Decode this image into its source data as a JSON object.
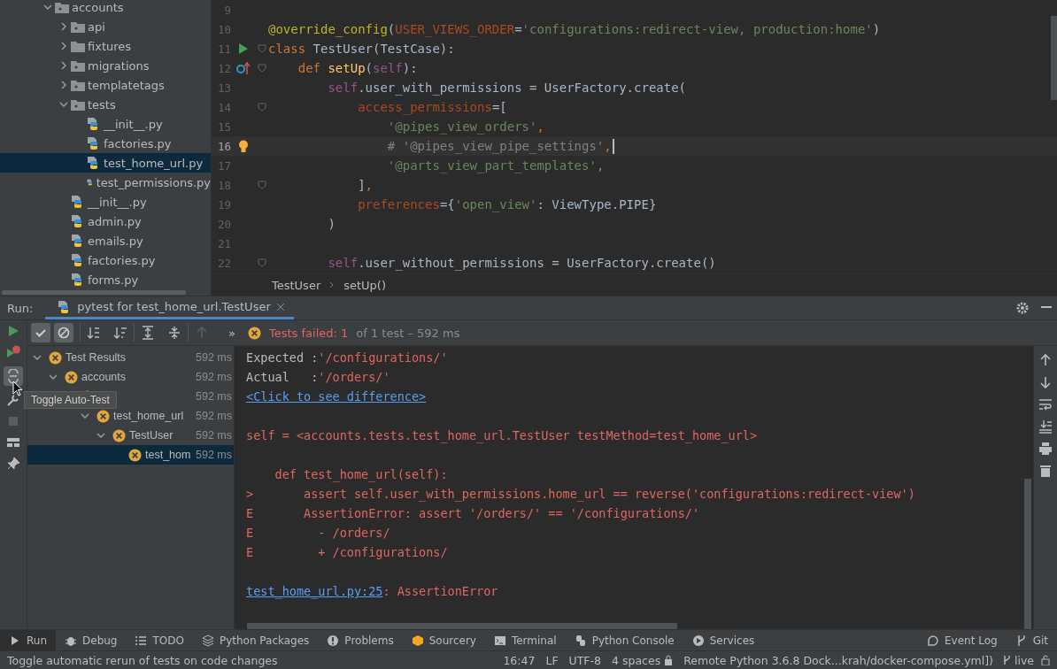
{
  "project_tree": [
    {
      "label": "accounts",
      "kind": "package",
      "expanded": true,
      "selected": false,
      "children": [
        {
          "label": "api",
          "kind": "package",
          "expanded": false,
          "selected": false
        },
        {
          "label": "fixtures",
          "kind": "folder",
          "expanded": false,
          "selected": false
        },
        {
          "label": "migrations",
          "kind": "package",
          "expanded": false,
          "selected": false
        },
        {
          "label": "templatetags",
          "kind": "package",
          "expanded": false,
          "selected": false
        },
        {
          "label": "tests",
          "kind": "package",
          "expanded": true,
          "selected": false,
          "children": [
            {
              "label": "__init__.py",
              "kind": "python",
              "selected": false
            },
            {
              "label": "factories.py",
              "kind": "python",
              "selected": false
            },
            {
              "label": "test_home_url.py",
              "kind": "python",
              "selected": true
            },
            {
              "label": "test_permissions.py",
              "kind": "python",
              "selected": false
            }
          ]
        },
        {
          "label": "__init__.py",
          "kind": "python",
          "selected": false
        },
        {
          "label": "admin.py",
          "kind": "python",
          "selected": false
        },
        {
          "label": "emails.py",
          "kind": "python",
          "selected": false
        },
        {
          "label": "factories.py",
          "kind": "python",
          "selected": false
        },
        {
          "label": "forms.py",
          "kind": "python",
          "selected": false
        }
      ]
    }
  ],
  "editor": {
    "lines": [
      {
        "number": "9"
      },
      {
        "number": "10",
        "tokens": [
          {
            "kind": "decorator",
            "text": "@override_config"
          },
          {
            "kind": "plain",
            "text": "("
          },
          {
            "kind": "param",
            "text": "USER_VIEWS_ORDER"
          },
          {
            "kind": "plain",
            "text": "="
          },
          {
            "kind": "string",
            "text": "'configurations:redirect-view, production:home'"
          },
          {
            "kind": "plain",
            "text": ")"
          }
        ]
      },
      {
        "number": "11",
        "kind": "run",
        "fold": true,
        "tokens": [
          {
            "kind": "keyword",
            "text": "class "
          },
          {
            "kind": "plain",
            "text": "TestUser(TestCase):"
          }
        ]
      },
      {
        "number": "12",
        "kind": "override",
        "fold": true,
        "tokens": [
          {
            "kind": "keyword",
            "text": "    def "
          },
          {
            "kind": "func",
            "text": "setUp"
          },
          {
            "kind": "plain",
            "text": "("
          },
          {
            "kind": "self",
            "text": "self"
          },
          {
            "kind": "plain",
            "text": "):"
          }
        ]
      },
      {
        "number": "13",
        "tokens": [
          {
            "kind": "self",
            "text": "        self"
          },
          {
            "kind": "plain",
            "text": ".user_with_permissions = UserFactory.create("
          }
        ]
      },
      {
        "number": "14",
        "fold": true,
        "tokens": [
          {
            "kind": "param",
            "text": "            access_permissions"
          },
          {
            "kind": "plain",
            "text": "=["
          }
        ]
      },
      {
        "number": "15",
        "tokens": [
          {
            "kind": "string",
            "text": "                '@pipes_view_orders'"
          },
          {
            "kind": "keyword",
            "text": ","
          }
        ]
      },
      {
        "number": "16",
        "kind": "bulb",
        "current": true,
        "tokens": [
          {
            "kind": "comment",
            "text": "                # '@pipes_view_pipe_settings'"
          },
          {
            "kind": "keyword",
            "text": ","
          }
        ]
      },
      {
        "number": "17",
        "tokens": [
          {
            "kind": "string",
            "text": "                '@parts_view_part_templates'"
          },
          {
            "kind": "keyword",
            "text": ","
          }
        ]
      },
      {
        "number": "18",
        "fold": true,
        "tokens": [
          {
            "kind": "plain",
            "text": "            ]"
          },
          {
            "kind": "keyword",
            "text": ","
          }
        ]
      },
      {
        "number": "19",
        "tokens": [
          {
            "kind": "param",
            "text": "            preferences"
          },
          {
            "kind": "plain",
            "text": "={"
          },
          {
            "kind": "string",
            "text": "'open_view'"
          },
          {
            "kind": "plain",
            "text": ": ViewType.PIPE}"
          }
        ]
      },
      {
        "number": "20",
        "tokens": [
          {
            "kind": "plain",
            "text": "        )"
          }
        ]
      },
      {
        "number": "21"
      },
      {
        "number": "22",
        "fold": true,
        "tokens": [
          {
            "kind": "self",
            "text": "        self"
          },
          {
            "kind": "plain",
            "text": ".user_without_permissions = UserFactory.create()"
          }
        ]
      }
    ],
    "breadcrumbs": [
      "TestUser",
      "setUp()"
    ]
  },
  "run_panel": {
    "label": "Run:",
    "tab": "pytest for test_home_url.TestUser",
    "toggles": [
      {
        "kind": "passed",
        "selected": true
      },
      {
        "kind": "ignored",
        "selected": true
      }
    ],
    "more": "»",
    "failed_label": "Tests failed: 1",
    "summary": "of 1 test – 592 ms",
    "tooltip": "Toggle Auto-Test",
    "results": [
      {
        "label": "Test Results",
        "duration": "592 ms",
        "expanded": true,
        "selected": false,
        "children": [
          {
            "label": "accounts",
            "duration": "592 ms",
            "expanded": true,
            "selected": false,
            "children": [
              {
                "duration": "592 ms",
                "selected": false,
                "children": [
                  {
                    "label": "test_home_url",
                    "duration": "592 ms",
                    "expanded": true,
                    "selected": false,
                    "children": [
                      {
                        "label": "TestUser",
                        "duration": "592 ms",
                        "expanded": true,
                        "selected": false,
                        "children": [
                          {
                            "label": "test_hom",
                            "duration": "592 ms",
                            "selected": true
                          }
                        ]
                      }
                    ]
                  }
                ]
              }
            ]
          }
        ]
      }
    ],
    "console": [
      {
        "kind": "output",
        "segments": [
          {
            "kind": "plain",
            "text": "Expected :"
          },
          {
            "kind": "error",
            "text": "'/configurations/'"
          }
        ]
      },
      {
        "kind": "output",
        "segments": [
          {
            "kind": "plain",
            "text": "Actual   :"
          },
          {
            "kind": "error",
            "text": "'/orders/'"
          }
        ]
      },
      {
        "kind": "output",
        "segments": [
          {
            "kind": "link",
            "text": "<Click to see difference>"
          }
        ]
      },
      {
        "kind": "blank"
      },
      {
        "kind": "output",
        "segments": [
          {
            "kind": "error",
            "text": "self = <accounts.tests.test_home_url.TestUser testMethod=test_home_url>"
          }
        ]
      },
      {
        "kind": "blank"
      },
      {
        "kind": "output",
        "segments": [
          {
            "kind": "error",
            "text": "    def test_home_url(self):"
          }
        ]
      },
      {
        "kind": "output",
        "segments": [
          {
            "kind": "error",
            "text": ">       assert self.user_with_permissions.home_url == reverse('configurations:redirect-view')"
          }
        ]
      },
      {
        "kind": "output",
        "segments": [
          {
            "kind": "error",
            "text": "E       AssertionError: assert '/orders/' == '/configurations/'"
          }
        ]
      },
      {
        "kind": "output",
        "segments": [
          {
            "kind": "error",
            "text": "E         - /orders/"
          }
        ]
      },
      {
        "kind": "output",
        "segments": [
          {
            "kind": "error",
            "text": "E         + /configurations/"
          }
        ]
      },
      {
        "kind": "blank"
      },
      {
        "kind": "output",
        "segments": [
          {
            "kind": "link",
            "text": "test_home_url.py:25"
          },
          {
            "kind": "error",
            "text": ": AssertionError"
          }
        ]
      }
    ]
  },
  "tool_tabs": [
    {
      "label": "Run",
      "kind": "run",
      "selected": true
    },
    {
      "label": "Debug",
      "kind": "debug",
      "selected": false
    },
    {
      "label": "TODO",
      "kind": "todo",
      "selected": false
    },
    {
      "label": "Python Packages",
      "kind": "packages",
      "selected": false
    },
    {
      "label": "Problems",
      "kind": "problems",
      "selected": false
    },
    {
      "label": "Sourcery",
      "kind": "sourcery",
      "selected": false
    },
    {
      "label": "Terminal",
      "kind": "terminal",
      "selected": false
    },
    {
      "label": "Python Console",
      "kind": "console",
      "selected": false
    },
    {
      "label": "Services",
      "kind": "services",
      "selected": false
    }
  ],
  "tool_tabs_right": [
    {
      "label": "Event Log",
      "kind": "log"
    },
    {
      "label": "Git",
      "kind": "git"
    }
  ],
  "status_bar": {
    "message": "Toggle automatic rerun of tests on code changes",
    "time": "16:47",
    "line_ending": "LF",
    "encoding": "UTF-8",
    "indent": "4 spaces",
    "interpreter": "Remote Python 3.6.8 Dock...krah/docker-compose.yml])",
    "branch": "live"
  }
}
